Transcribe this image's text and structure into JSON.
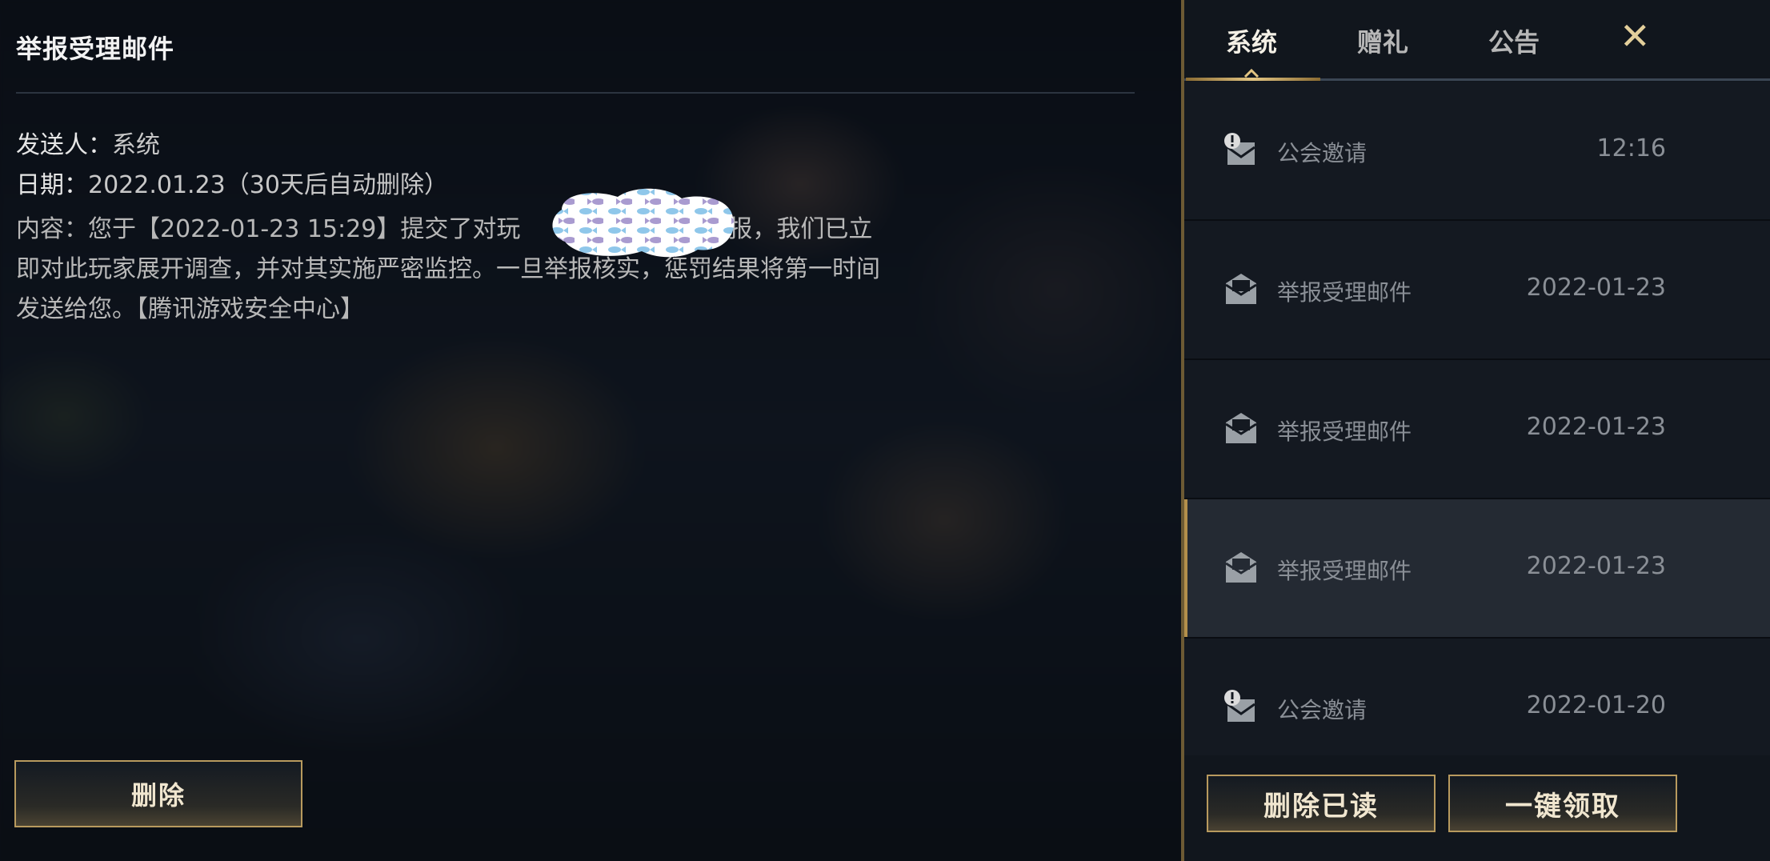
{
  "mail_detail": {
    "title": "举报受理邮件",
    "sender_label": "发送人：",
    "sender_value": "系统",
    "date_label": "日期：",
    "date_value": "2022.01.23（30天后自动删除）",
    "content_part1": "内容：您于【2022-01-23 15:29】提交了对玩",
    "content_part2": "的举报，我们已立即对此玩家展开调查，并对其实施严密监控。一旦举报核实，惩罚结果将第一时间发送给您。【腾讯游戏安全中心】",
    "delete_button": "删除"
  },
  "tabs": {
    "system": "系统",
    "gift": "赠礼",
    "notice": "公告",
    "close": "✕"
  },
  "mail_list": [
    {
      "name": "公会邀请",
      "time": "12:16",
      "icon": "guild-invite-icon"
    },
    {
      "name": "举报受理邮件",
      "time": "2022-01-23",
      "icon": "mail-read-icon"
    },
    {
      "name": "举报受理邮件",
      "time": "2022-01-23",
      "icon": "mail-read-icon"
    },
    {
      "name": "举报受理邮件",
      "time": "2022-01-23",
      "icon": "mail-read-icon",
      "selected": true
    },
    {
      "name": "公会邀请",
      "time": "2022-01-20",
      "icon": "guild-invite-icon"
    }
  ],
  "bottom_buttons": {
    "delete_read": "删除已读",
    "claim_all": "一键领取"
  },
  "colors": {
    "accent_gold": "#b89a5e",
    "panel_bg": "#11161d",
    "selected_row": "#242a33"
  }
}
